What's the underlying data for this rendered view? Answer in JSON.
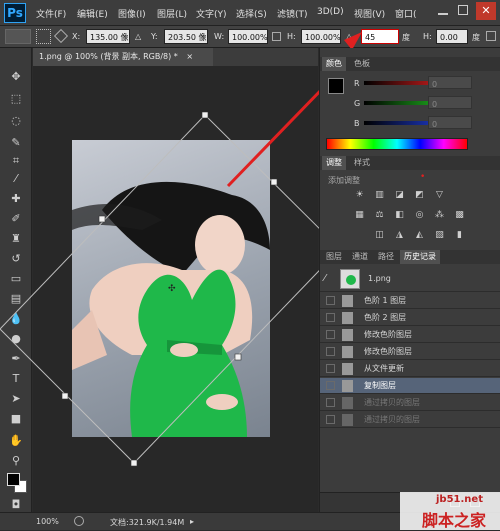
{
  "app": {
    "logo": "Ps"
  },
  "menu": [
    "文件(F)",
    "编辑(E)",
    "图像(I)",
    "图层(L)",
    "文字(Y)",
    "选择(S)",
    "滤镜(T)",
    "3D(D)",
    "视图(V)",
    "窗口("
  ],
  "options": {
    "x_label": "X:",
    "x_value": "135.00 像",
    "y_label": "Y:",
    "y_value": "203.50 像",
    "w_label": "W:",
    "w_value": "100.00%",
    "h_label": "H:",
    "h_value": "100.00%",
    "angle_label": "△",
    "angle_value": "45",
    "angle_unit": "度",
    "hskew_label": "H:",
    "hskew_value": "0.00"
  },
  "document": {
    "tab_title": "1.png @ 100% (背景 副本, RGB/8) *",
    "close": "×"
  },
  "status": {
    "zoom": "100%",
    "doc_info": "文档:321.9K/1.94M"
  },
  "panels": {
    "color_tabs": [
      "颜色",
      "色板"
    ],
    "color_channels": [
      {
        "label": "R",
        "value": "0",
        "color": "#e02020"
      },
      {
        "label": "G",
        "value": "0",
        "color": "#20c020"
      },
      {
        "label": "B",
        "value": "0",
        "color": "#2040e0"
      }
    ],
    "adjust_tabs": [
      "调整",
      "样式"
    ],
    "adjust_title": "添加调整",
    "layers_tabs": [
      "图层",
      "通道",
      "路径",
      "历史记录"
    ],
    "history_snapshot": "1.png",
    "history": [
      "色阶 1 图层",
      "色阶 2 图层",
      "修改色阶图层",
      "修改色阶图层",
      "从文件更新",
      "复制图层",
      "通过拷贝的图层",
      "通过拷贝的图层"
    ]
  },
  "watermark": {
    "site": "jb51.net",
    "name": "脚本之家"
  },
  "colors": {
    "accent_arrow": "#e02020",
    "dress": "#1fb84a"
  }
}
